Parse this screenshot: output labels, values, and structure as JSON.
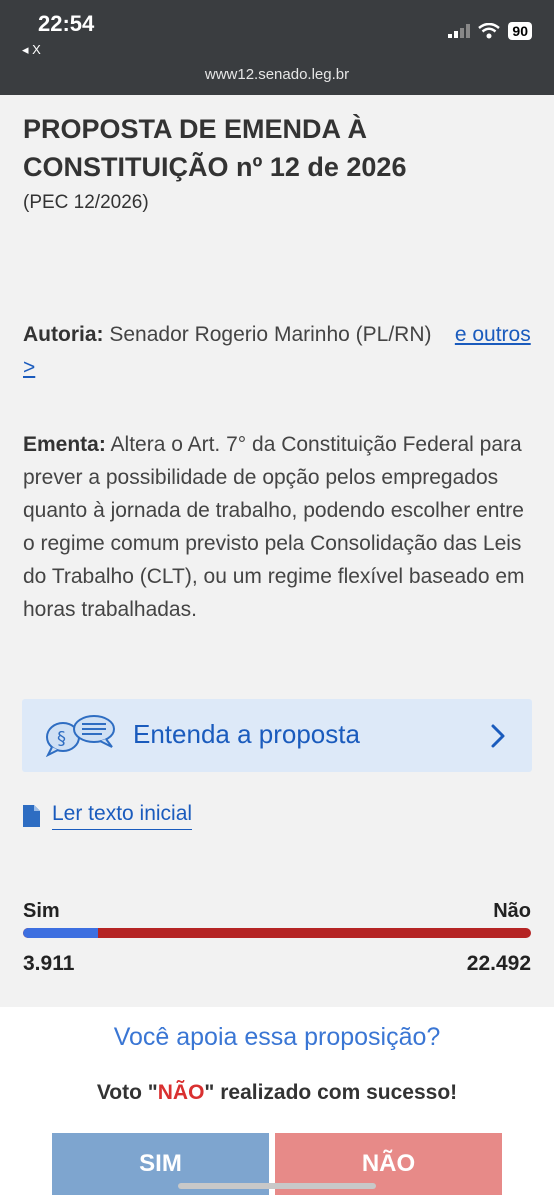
{
  "status_bar": {
    "time": "22:54",
    "back": "◂ X",
    "battery": "90",
    "url": "www12.senado.leg.br"
  },
  "proposal": {
    "title": "PROPOSTA DE EMENDA À CONSTITUIÇÃO nº 12 de 2026",
    "code": "(PEC 12/2026)",
    "authorship_label": "Autoria:",
    "authorship_value": "Senador Rogerio Marinho (PL/RN)",
    "authorship_link": "e outros >",
    "ementa_label": "Ementa:",
    "ementa_text": "Altera o Art. 7° da Constituição Federal para prever a possibilidade de opção pelos empregados quanto à jornada de trabalho, podendo escolher entre o regime comum previsto pela Consolidação das Leis do Trabalho (CLT), ou um regime flexível baseado em horas trabalhadas."
  },
  "entenda": {
    "label": "Entenda a proposta",
    "icon": "law-speech-bubbles-icon"
  },
  "ler_texto": {
    "label": "Ler texto inicial",
    "icon": "document-icon"
  },
  "votes": {
    "sim_label": "Sim",
    "nao_label": "Não",
    "sim_count": "3.911",
    "nao_count": "22.492",
    "sim_fraction": 0.148,
    "sim_color": "#3d6fe0",
    "nao_color": "#b52424"
  },
  "bottom_panel": {
    "question": "Você apoia essa proposição?",
    "status_prefix": "Voto \"",
    "status_highlight": "NÃO",
    "status_suffix": "\" realizado com sucesso!",
    "sim_button": "SIM",
    "nao_button": "NÃO"
  }
}
